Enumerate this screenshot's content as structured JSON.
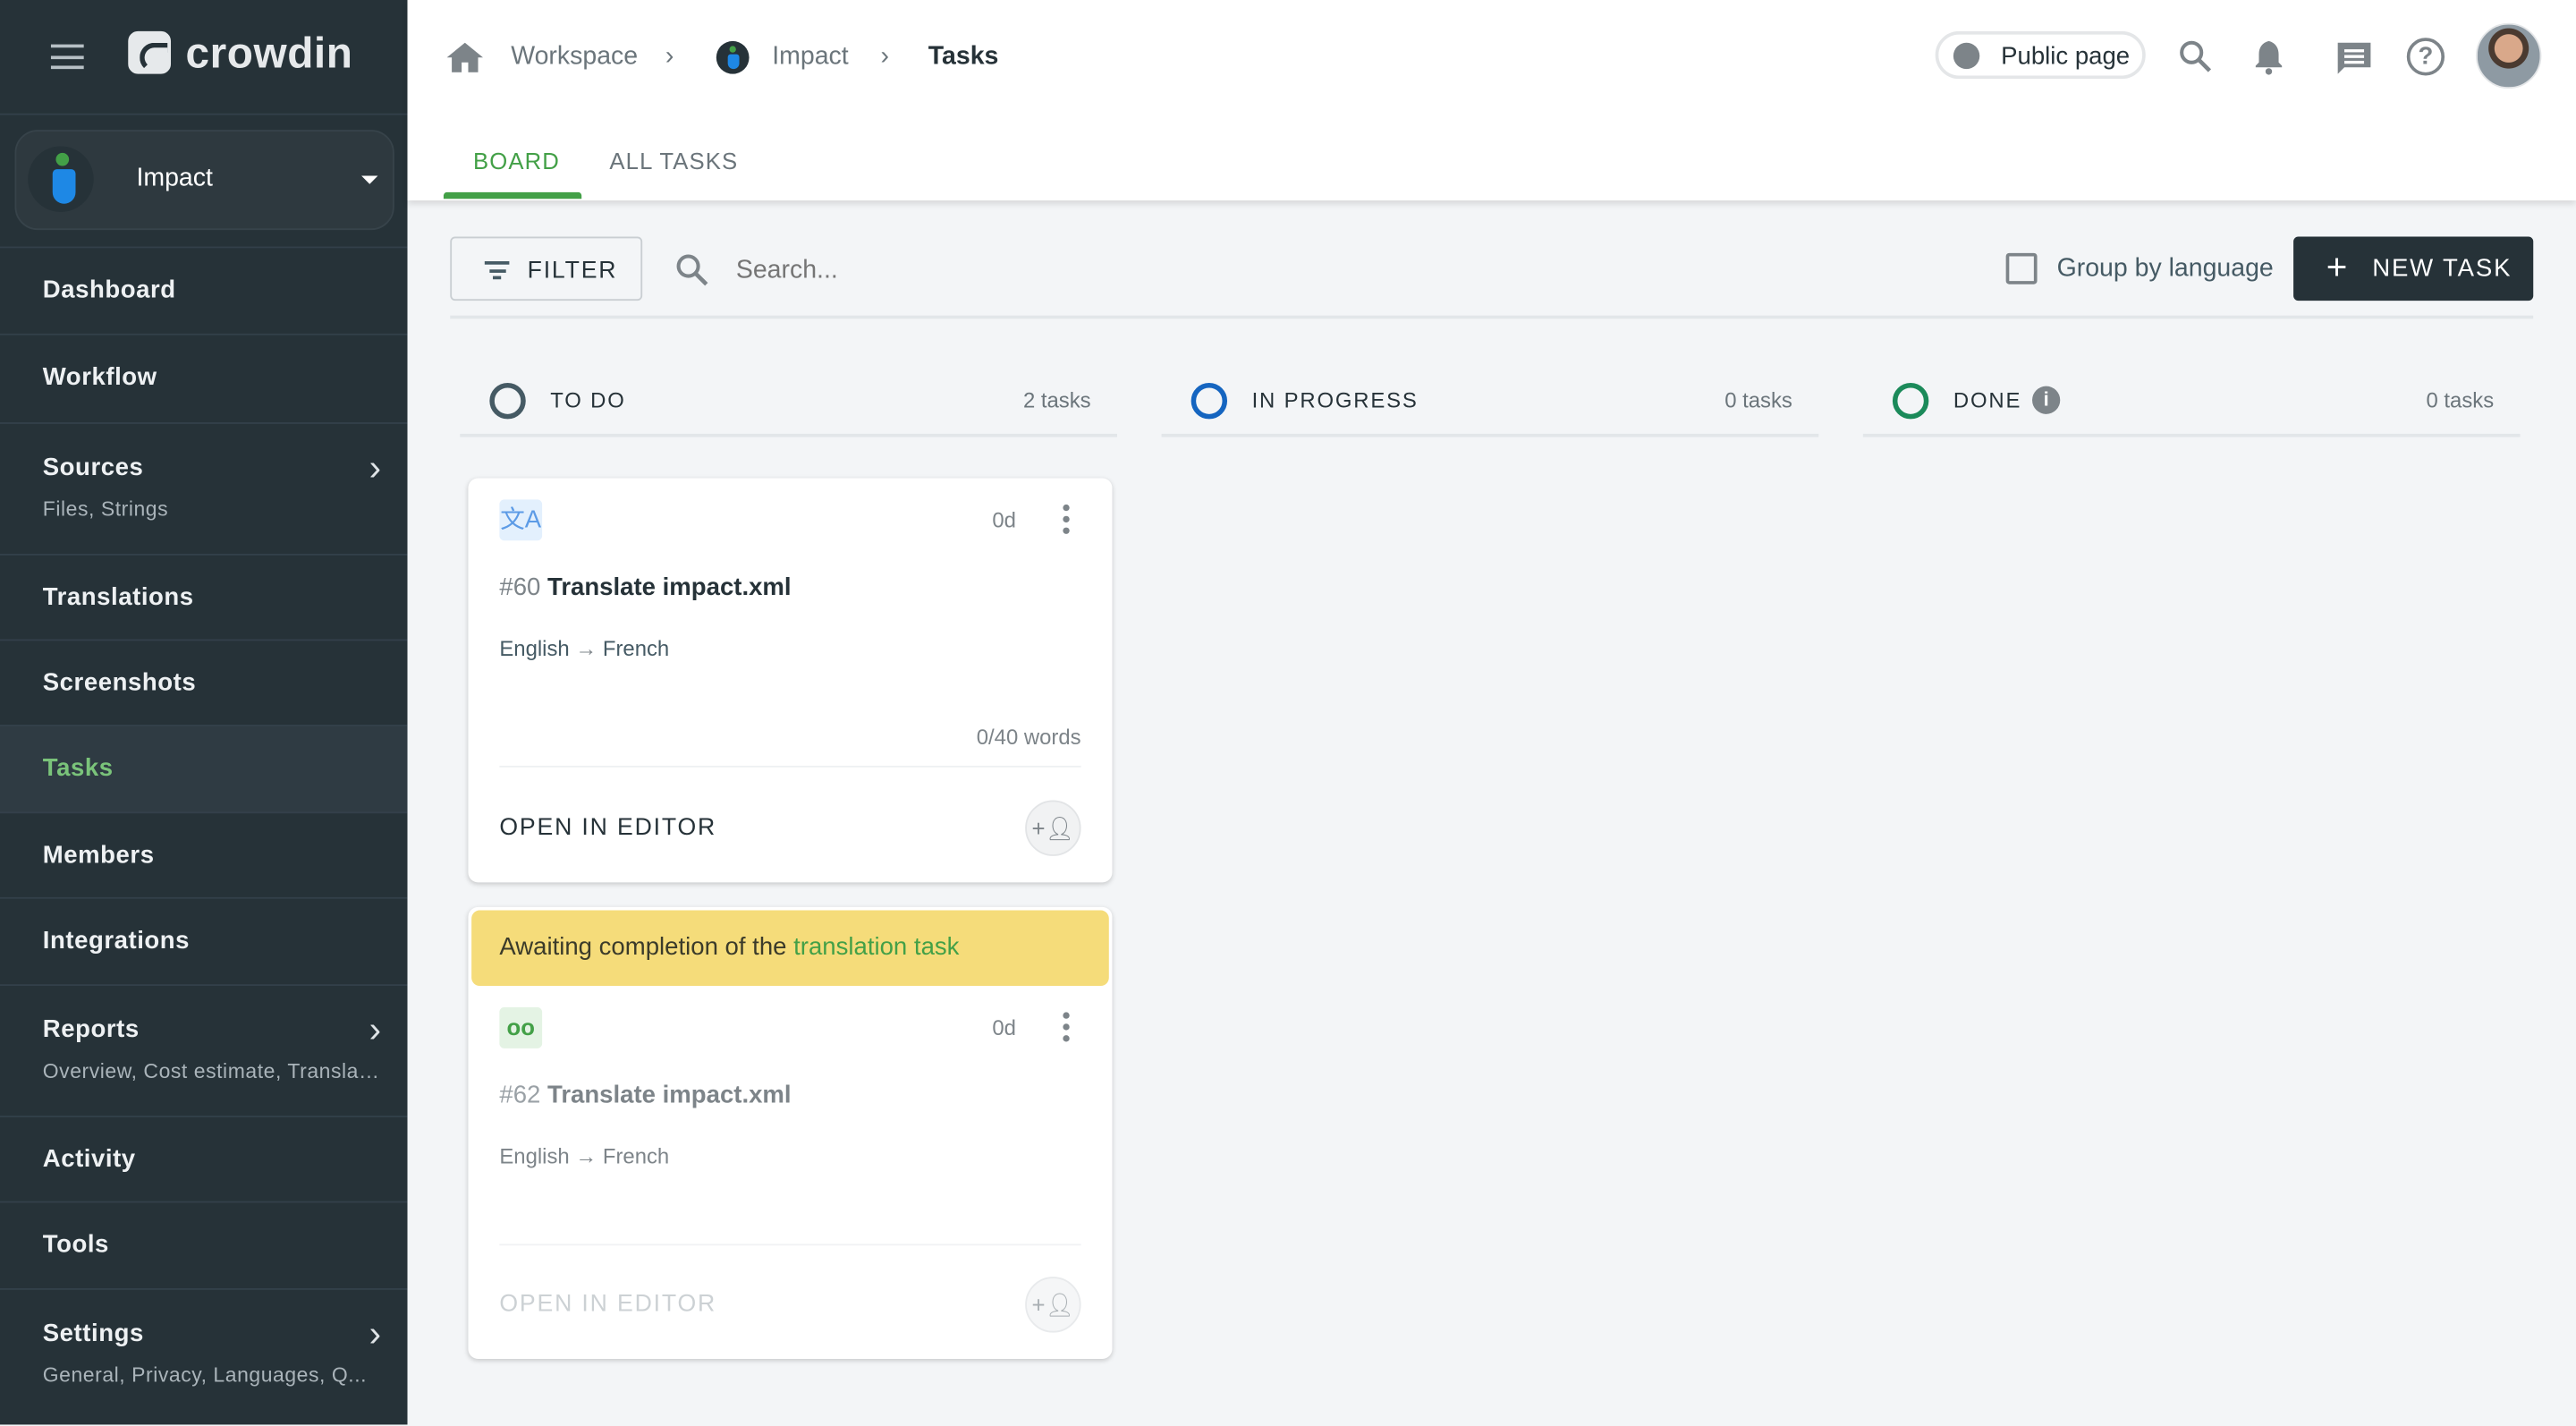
{
  "app": {
    "brand": "crowdin",
    "project": "Impact"
  },
  "sidebar": {
    "items": [
      {
        "label": "Dashboard"
      },
      {
        "label": "Workflow"
      },
      {
        "label": "Sources",
        "sub": "Files, Strings"
      },
      {
        "label": "Translations"
      },
      {
        "label": "Screenshots"
      },
      {
        "label": "Tasks",
        "active": true
      },
      {
        "label": "Members"
      },
      {
        "label": "Integrations"
      },
      {
        "label": "Reports",
        "sub": "Overview, Cost estimate, Translation..."
      },
      {
        "label": "Activity"
      },
      {
        "label": "Tools"
      },
      {
        "label": "Settings",
        "sub": "General, Privacy, Languages, Q..."
      }
    ]
  },
  "breadcrumb": [
    "Workspace",
    "Impact",
    "Tasks"
  ],
  "header": {
    "public_page": "Public page"
  },
  "tabs": [
    {
      "label": "BOARD",
      "active": true
    },
    {
      "label": "ALL TASKS"
    }
  ],
  "toolbar": {
    "filter": "FILTER",
    "search_placeholder": "Search...",
    "group_by": "Group by language",
    "new_task": "NEW TASK"
  },
  "columns": [
    {
      "title": "TO DO",
      "count": "2 tasks",
      "color": "#455a64"
    },
    {
      "title": "IN PROGRESS",
      "count": "0 tasks",
      "color": "#1565c0"
    },
    {
      "title": "DONE",
      "count": "0 tasks",
      "color": "#1b8a5a"
    }
  ],
  "cards": [
    {
      "id": "#60",
      "title": "Translate impact.xml",
      "age": "0d",
      "source": "English",
      "target": "French",
      "words": "0/40 words",
      "action": "OPEN IN EDITOR",
      "type_icon": "translate-icon"
    },
    {
      "banner_prefix": "Awaiting completion of the ",
      "banner_link": "translation task",
      "id": "#62",
      "title": "Translate impact.xml",
      "age": "0d",
      "source": "English",
      "target": "French",
      "action": "OPEN IN EDITOR",
      "type_icon": "proofread-icon"
    }
  ],
  "colors": {
    "sidebar": "#263238",
    "accent": "#43a047",
    "banner": "#f5dc7a"
  }
}
